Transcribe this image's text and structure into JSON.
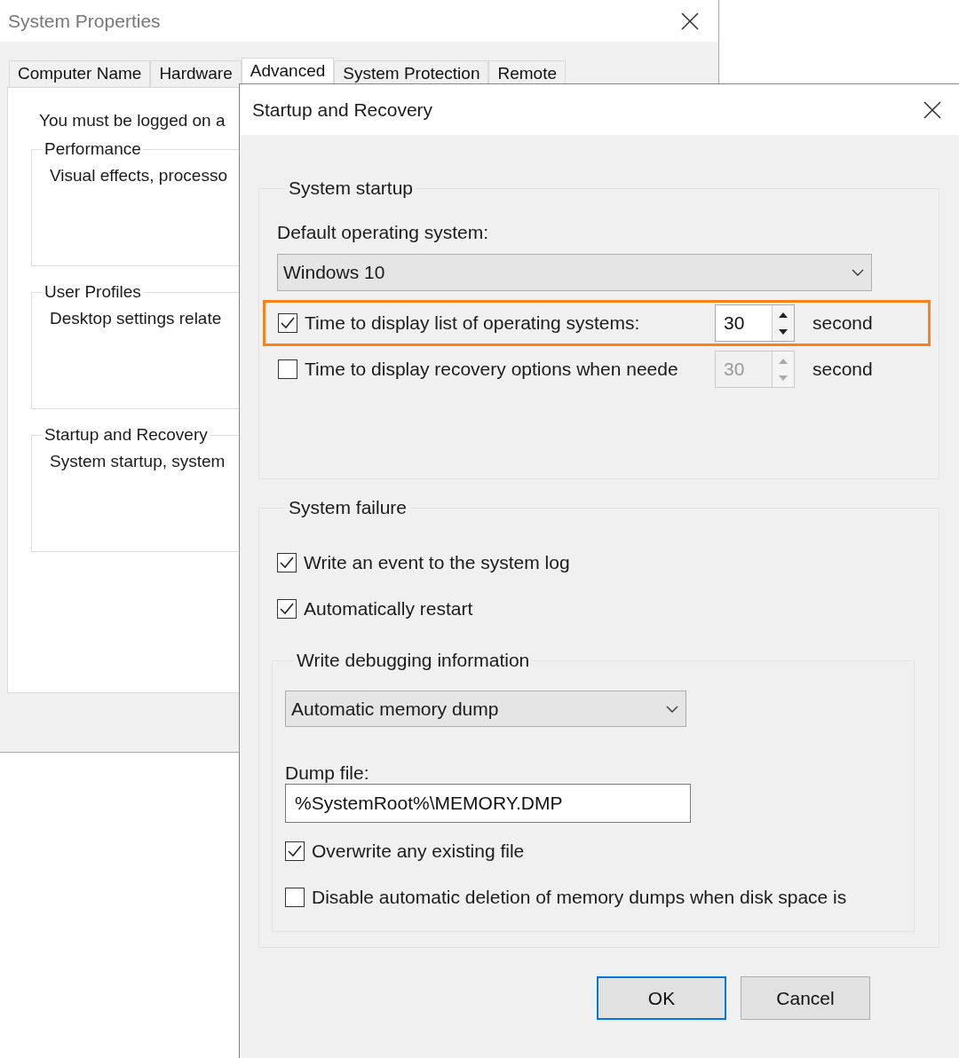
{
  "background_window": {
    "title": "System Properties",
    "tabs": [
      {
        "label": "Computer Name",
        "selected": false
      },
      {
        "label": "Hardware",
        "selected": false
      },
      {
        "label": "Advanced",
        "selected": true
      },
      {
        "label": "System Protection",
        "selected": false
      },
      {
        "label": "Remote",
        "selected": false
      }
    ],
    "notice": "You must be logged on a",
    "groups": [
      {
        "title": "Performance",
        "description": "Visual effects, processo"
      },
      {
        "title": "User Profiles",
        "description": "Desktop settings relate"
      },
      {
        "title": "Startup and Recovery",
        "description": "System startup, system"
      }
    ]
  },
  "dialog": {
    "title": "Startup and Recovery",
    "system_startup": {
      "title": "System startup",
      "default_os_label": "Default operating system:",
      "default_os": "Windows 10",
      "options": [
        {
          "label": "Time to display list of operating systems:",
          "checked": true,
          "value": "30",
          "unit": "second",
          "highlighted": true,
          "disabled": false
        },
        {
          "label": "Time to display recovery options when neede",
          "checked": false,
          "value": "30",
          "unit": "second",
          "highlighted": false,
          "disabled": true
        }
      ]
    },
    "system_failure": {
      "title": "System failure",
      "options": [
        {
          "label": "Write an event to the system log",
          "checked": true
        },
        {
          "label": "Automatically restart",
          "checked": true
        }
      ],
      "debugging": {
        "title": "Write debugging information",
        "dump_type": "Automatic memory dump",
        "dump_file_label": "Dump file:",
        "dump_file": "%SystemRoot%\\MEMORY.DMP",
        "options": [
          {
            "label": "Overwrite any existing file",
            "checked": true
          },
          {
            "label": "Disable automatic deletion of memory dumps when disk space is",
            "checked": false
          }
        ]
      }
    },
    "buttons": [
      {
        "label": "OK",
        "default": true
      },
      {
        "label": "Cancel",
        "default": false
      }
    ]
  }
}
